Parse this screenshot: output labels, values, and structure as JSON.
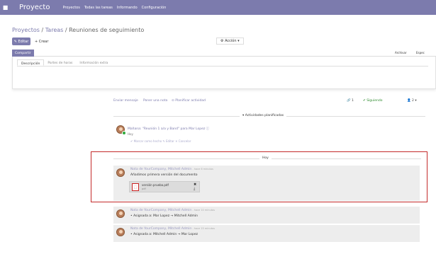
{
  "navbar": {
    "app_name": "Proyecto",
    "links": [
      "Proyectos",
      "Todas las tareas",
      "Informando",
      "Configuración"
    ]
  },
  "breadcrumb": {
    "part1": "Proyectos",
    "sep1": " / ",
    "part2": "Tareas",
    "sep2": " / ",
    "current": "Reuniones de seguimiento"
  },
  "toolbar": {
    "edit_label": "✎ Editar",
    "create_label": "+ Crear",
    "action_label": "⚙ Acción ▾"
  },
  "statusbar": {
    "share_label": "Compartir",
    "archive_label": "Archivar",
    "expect_label": "Espec"
  },
  "tabs": [
    "Descripción",
    "Partes de horas",
    "Información extra"
  ],
  "chatter": {
    "send_message": "Enviar mensaje",
    "log_note": "Poner una nota",
    "schedule": "⊙ Planificar actividad",
    "attach_count": "🔗 1",
    "following": "✔ Siguiendo",
    "followers": "👤 2 ▾"
  },
  "planned_activities_label": "▾ Actividades planificadas",
  "activity": {
    "text": "Mañana: \"Reunión 1 a/a y Band\" para Mar Lopez ⓘ",
    "today": "Hoy",
    "actions": "✔ Marcar como hecho    ✎ Editar    ✕ Cancelar"
  },
  "today_label": "Hoy",
  "messages": [
    {
      "author": "Nota de YourCompany, Mitchell Admin",
      "time": " - hace 6 minutos",
      "body": "Añadimos primera versión del documento",
      "attachment": {
        "name": "versión prueba.pdf",
        "ext": "pdf"
      }
    },
    {
      "author": "Nota de YourCompany, Mitchell Admin",
      "time": " - hace 10 minutos",
      "body": "•  Asignada a: Mar Lopez → Mitchell Admin"
    },
    {
      "author": "Nota de YourCompany, Mitchell Admin",
      "time": " - hace 15 minutos",
      "body": "•  Asignada a: Mitchell Admin → Mar Lopez"
    }
  ],
  "colors": {
    "brand": "#7c7bad",
    "highlight": "#c42a2a",
    "following": "#2e8b2e"
  }
}
